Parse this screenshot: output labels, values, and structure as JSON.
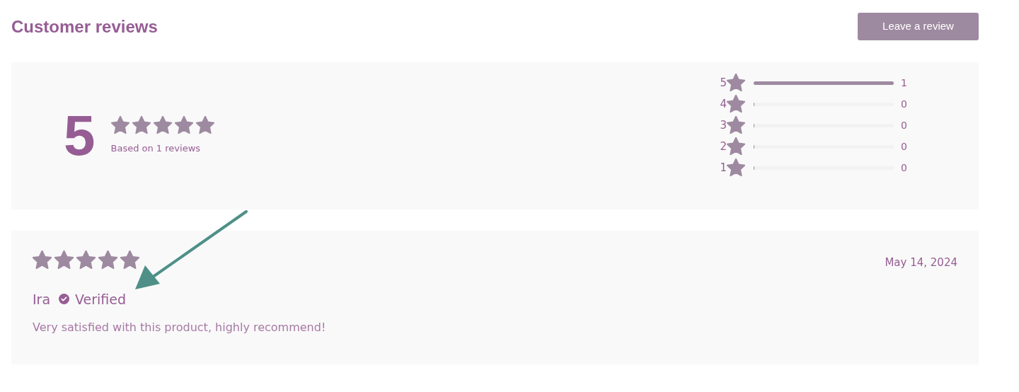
{
  "header": {
    "title": "Customer reviews",
    "button": "Leave a review"
  },
  "summary": {
    "score": "5",
    "stars": 5,
    "caption": "Based on 1 reviews"
  },
  "distribution": [
    {
      "label": "5",
      "level": 1,
      "count": "1"
    },
    {
      "label": "4",
      "level": 0,
      "count": "0"
    },
    {
      "label": "3",
      "level": 0,
      "count": "0"
    },
    {
      "label": "2",
      "level": 0,
      "count": "0"
    },
    {
      "label": "1",
      "level": 0,
      "count": "0"
    }
  ],
  "reviews": [
    {
      "stars": 5,
      "date": "May 14, 2024",
      "author": "Ira",
      "verified": true,
      "badge": "Verified",
      "text": "Very satisfied with this product, highly recommend!"
    }
  ]
}
